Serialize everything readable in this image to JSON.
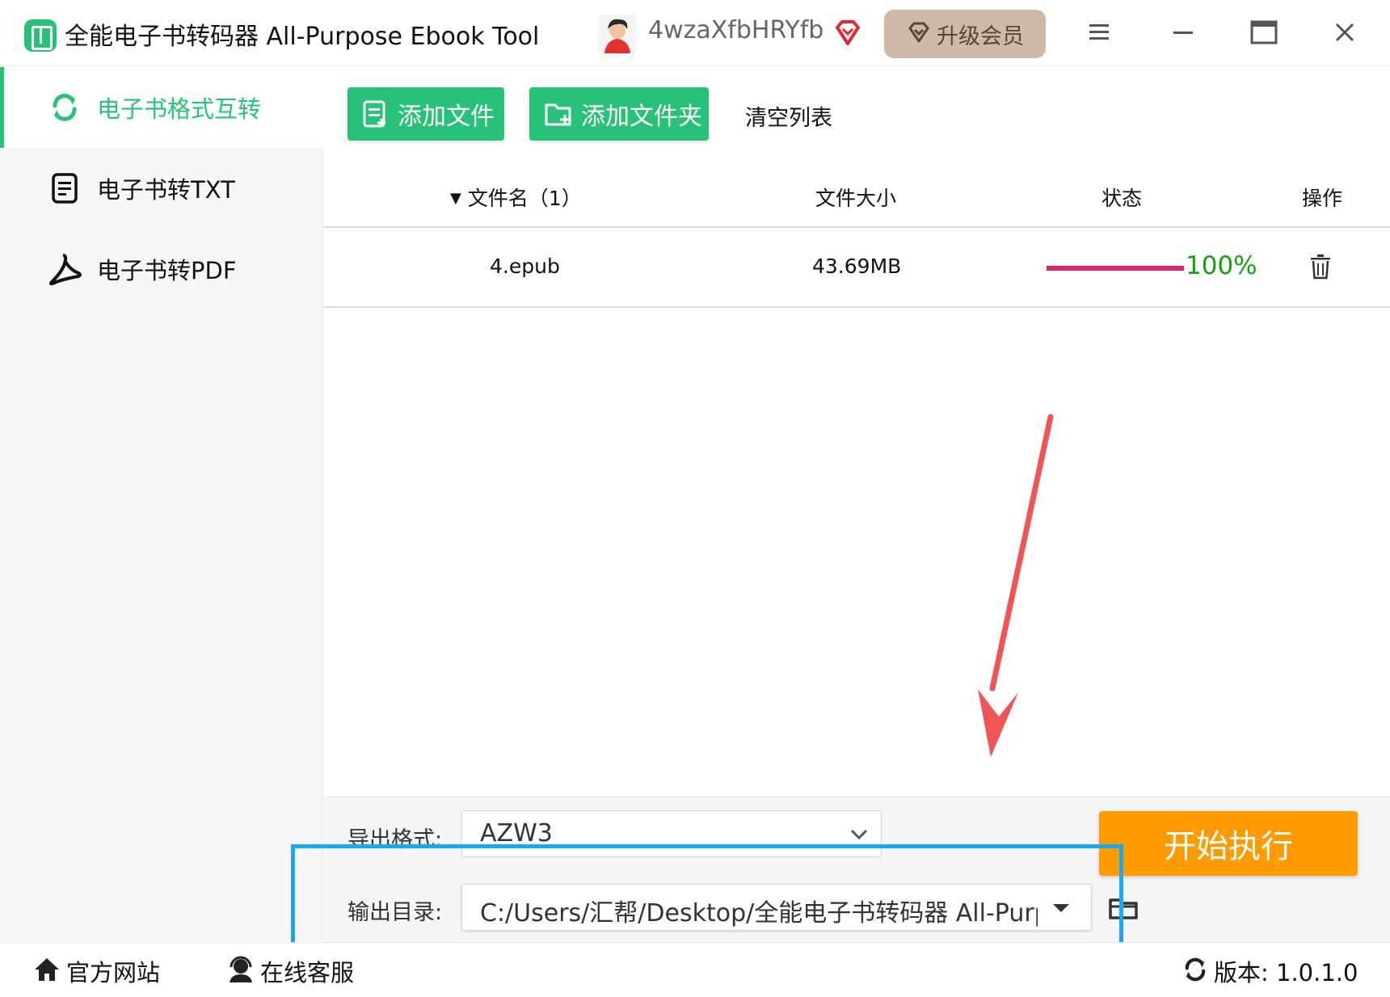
{
  "app": {
    "title": "全能电子书转码器 All-Purpose Ebook Tool",
    "username": "4wzaXfbHRYfb",
    "upgrade_label": "升级会员"
  },
  "sidebar": {
    "items": [
      {
        "label": "电子书格式互转",
        "icon": "refresh-icon",
        "active": true
      },
      {
        "label": "电子书转TXT",
        "icon": "document-icon",
        "active": false
      },
      {
        "label": "电子书转PDF",
        "icon": "pdf-icon",
        "active": false
      }
    ]
  },
  "toolbar": {
    "add_file_label": "添加文件",
    "add_folder_label": "添加文件夹",
    "clear_label": "清空列表"
  },
  "table": {
    "headers": {
      "filename": "文件名（1）",
      "size": "文件大小",
      "status": "状态",
      "action": "操作"
    },
    "rows": [
      {
        "filename": "4.epub",
        "size": "43.69MB",
        "progress": 1.0,
        "progress_text": "100%"
      }
    ]
  },
  "output": {
    "format_label": "导出格式:",
    "format_value": "AZW3",
    "dir_label": "输出目录:",
    "dir_value": "C:/Users/汇帮/Desktop/全能电子书转码器 All-Purpose Ebook Tool"
  },
  "start_label": "开始执行",
  "statusbar": {
    "website_label": "官方网站",
    "service_label": "在线客服",
    "version_label": "版本: 1.0.1.0"
  },
  "colors": {
    "accent": "#27c277",
    "start": "#ff9a00",
    "progress": "#e02266",
    "percent": "#13a10e",
    "highlight": "#1ba8ee",
    "annotation_arrow": "#f05454"
  }
}
